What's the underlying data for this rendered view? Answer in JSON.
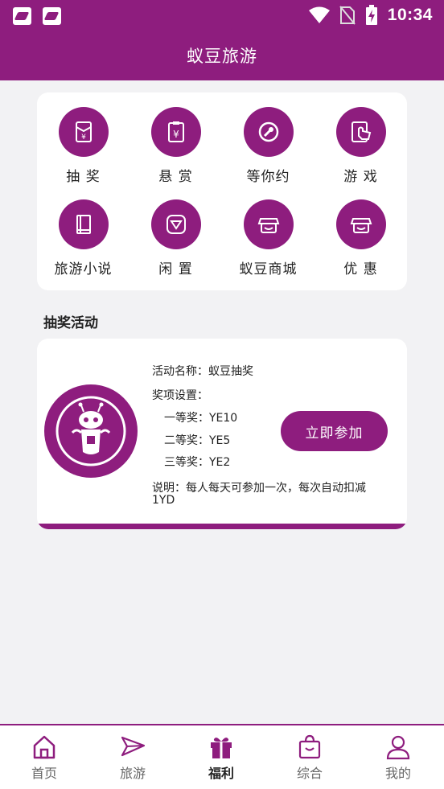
{
  "status_bar": {
    "time": "10:34"
  },
  "header": {
    "title": "蚁豆旅游"
  },
  "grid": [
    {
      "label": "抽  奖",
      "icon": "red-envelope-icon"
    },
    {
      "label": "悬  赏",
      "icon": "reward-clipboard-icon"
    },
    {
      "label": "等你约",
      "icon": "wrench-icon"
    },
    {
      "label": "游  戏",
      "icon": "touch-hand-icon"
    },
    {
      "label": "旅游小说",
      "icon": "book-icon"
    },
    {
      "label": "闲  置",
      "icon": "diamond-icon"
    },
    {
      "label": "蚁豆商城",
      "icon": "shop-icon"
    },
    {
      "label": "优  惠",
      "icon": "store-icon"
    }
  ],
  "section": {
    "title": "抽奖活动"
  },
  "lottery": {
    "name": "活动名称：蚁豆抽奖",
    "prizes_title": "奖项设置：",
    "prizes": [
      "一等奖：YE10",
      "二等奖：YE5",
      "三等奖：YE2"
    ],
    "note_line1": "说明：每人每天可参加一次，每次自动扣减",
    "note_line2": "1YD",
    "button": "立即参加"
  },
  "nav": [
    {
      "label": "首页",
      "icon": "home-icon"
    },
    {
      "label": "旅游",
      "icon": "paper-plane-icon"
    },
    {
      "label": "福利",
      "icon": "gift-icon",
      "active": true
    },
    {
      "label": "综合",
      "icon": "shopping-bag-icon"
    },
    {
      "label": "我的",
      "icon": "user-icon"
    }
  ],
  "colors": {
    "primary": "#8e1d7e",
    "background": "#f2f2f4"
  }
}
